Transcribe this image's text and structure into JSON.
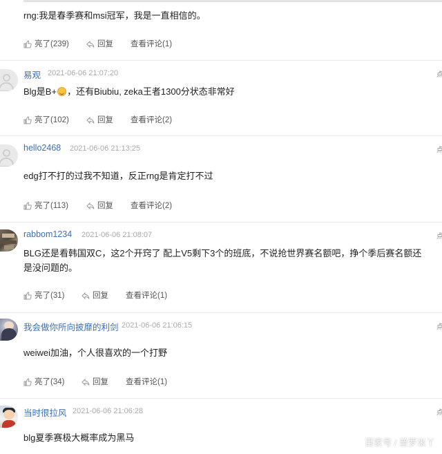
{
  "comments": [
    {
      "content": "rng:我是春季赛和msi冠军，我是一直相信的。",
      "like": "亮了(239)",
      "reply": "回复",
      "view": "查看评论(1)"
    },
    {
      "username": "易观",
      "time": "2021-06-06 21:07:20",
      "content_before": "Blg是B+",
      "content_after": "，还有Biubiu, zeka王者1300分状态非常好",
      "like": "亮了(102)",
      "reply": "回复",
      "view": "查看评论(2)"
    },
    {
      "username": "hello2468",
      "time": "2021-06-06 21:13:25",
      "content": "edg打不打的过我不知道，反正rng是肯定打不过",
      "like": "亮了(113)",
      "reply": "回复",
      "view": "查看评论(2)"
    },
    {
      "username": "rabbom1234",
      "time": "2021-06-06 21:08:07",
      "content": "BLG还是看韩国双C，这2个开窍了 配上V5剩下3个的班底，不说抢世界赛名额吧，挣个季后赛名额还是没问题的。",
      "like": "亮了(31)",
      "reply": "回复",
      "view": "查看评论(1)"
    },
    {
      "username": "我会做你所向披靡的利剑",
      "time": "2021-06-06 21:06:15",
      "content": "weiwei加油，个人很喜欢的一个打野",
      "like": "亮了(34)",
      "reply": "回复",
      "view": "查看评论(1)"
    },
    {
      "username": "当时很拉风",
      "time": "2021-06-06 21:06:28",
      "content": "blg夏季赛极大概率成为黑马"
    }
  ],
  "more_glyph": "点",
  "watermark": "百家号 / 普罗米丫",
  "icons": {
    "like": "thumbs-up-icon",
    "reply": "reply-arrow-icon",
    "more": "more-options-icon"
  },
  "colors": {
    "username": "#3d6fb6",
    "timestamp": "#aaaaaa",
    "action_text": "#555555"
  }
}
